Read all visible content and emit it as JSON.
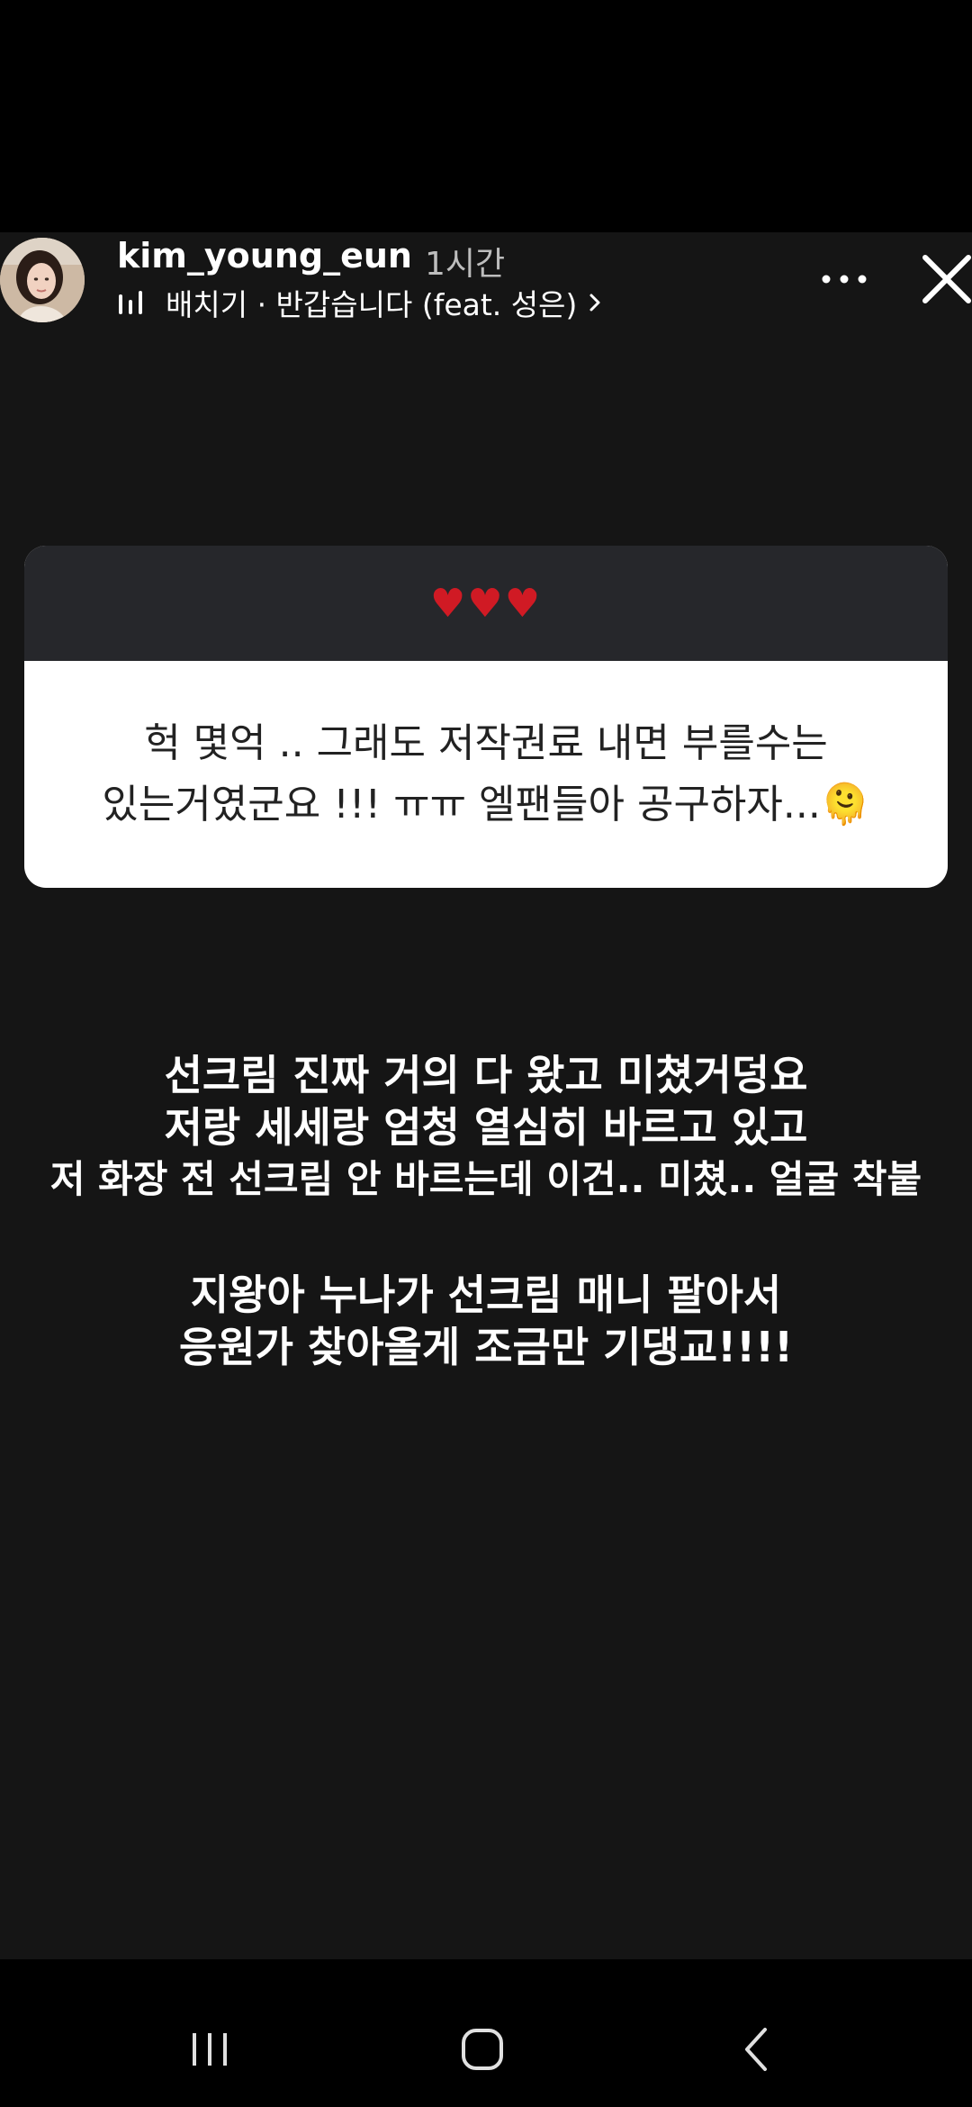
{
  "header": {
    "username": "kim_young_eun",
    "time_ago": "1시간",
    "music": "배치기 · 반갑습니다 (feat. 성은)"
  },
  "question_box": {
    "header_emoji": "♥♥♥",
    "line1": "헉 몇억 .. 그래도 저작권료 내면 부를수는",
    "line2": "있는거였군요 !!! ㅠㅠ 엘팬들아 공구하자...🫠"
  },
  "caption": {
    "line1": "선크림 진짜 거의 다 왔고 미쳤거덩요",
    "line2": "저랑 세세랑 엄청 열심히 바르고 있고",
    "line3": "저 화장 전 선크림 안 바르는데 이건.. 미쳤.. 얼굴 착붙",
    "line4": "지왕아 누나가 선크림 매니 팔아서",
    "line5": "응원가 찾아올게 조금만 기댕교!!!!"
  },
  "colors": {
    "status_bg": "#000000",
    "story_bg": "#151515",
    "card_header_bg": "#26272b",
    "card_body_bg": "#ffffff",
    "heart": "#d01a24"
  },
  "icons": {
    "music": "music-bars-icon",
    "more": "more-dots-icon",
    "close": "close-icon",
    "recents": "recent-apps-icon",
    "home": "home-icon",
    "back": "back-icon"
  }
}
